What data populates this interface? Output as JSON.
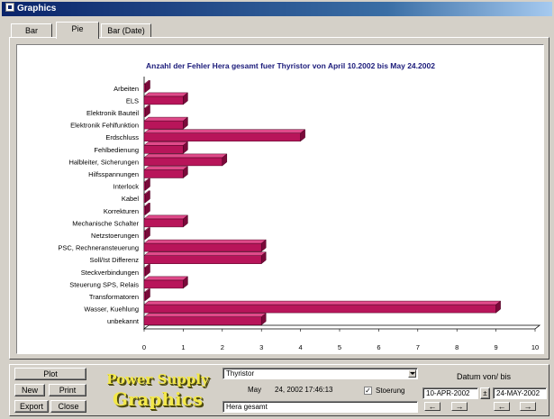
{
  "window": {
    "title": "Graphics"
  },
  "tabs": [
    {
      "label": "Bar",
      "active": false
    },
    {
      "label": "Pie",
      "active": true
    },
    {
      "label": "Bar (Date)",
      "active": false
    }
  ],
  "chart_data": {
    "type": "bar",
    "orientation": "horizontal",
    "style": "3d",
    "title": "Anzahl der Fehler Hera gesamt fuer Thyristor von April     10.2002 bis May     24.2002",
    "categories": [
      "Arbeiten",
      "ELS",
      "Elektronik Bauteil",
      "Elektronik Fehlfunktion",
      "Erdschluss",
      "Fehlbedienung",
      "Halbleiter, Sicherungen",
      "Hilfsspannungen",
      "Interlock",
      "Kabel",
      "Korrekturen",
      "Mechanische Schalter",
      "Netzstoerungen",
      "PSC, Rechneransteuerung",
      "Soll/Ist Differenz",
      "Steckverbindungen",
      "Steuerung SPS, Relais",
      "Transformatoren",
      "Wasser, Kuehlung",
      "unbekannt"
    ],
    "values": [
      0,
      1,
      0,
      1,
      4,
      1,
      2,
      1,
      0,
      0,
      0,
      1,
      0,
      3,
      3,
      0,
      1,
      0,
      9,
      3
    ],
    "x_ticks": [
      "0",
      "1",
      "2",
      "3",
      "4",
      "5",
      "6",
      "7",
      "8",
      "9",
      "10"
    ],
    "xlim": [
      0,
      10
    ],
    "bar_color": "#b8155a",
    "bar_top_color": "#e04a8a",
    "bar_side_color": "#7a0a3a",
    "title_color": "#1a1a7a",
    "grid": false,
    "legend": "none"
  },
  "buttons": {
    "plot": "Plot",
    "new": "New",
    "print": "Print",
    "export": "Export",
    "close": "Close"
  },
  "logo": {
    "line1": "Power Supply",
    "line2": "Graphics"
  },
  "filter": {
    "device": "Thyristor",
    "month": "May",
    "timestamp": "24, 2002 17:46:13",
    "stoerung_label": "Stoerung",
    "stoerung_checked": true,
    "checkbox_mark": "✓",
    "category": "Hera gesamt"
  },
  "date_range": {
    "label": "Datum von/ bis",
    "from": "10-APR-2002",
    "to": "24-MAY-2002",
    "swap_glyph": "±",
    "arrow_left": "←",
    "arrow_right": "→"
  }
}
